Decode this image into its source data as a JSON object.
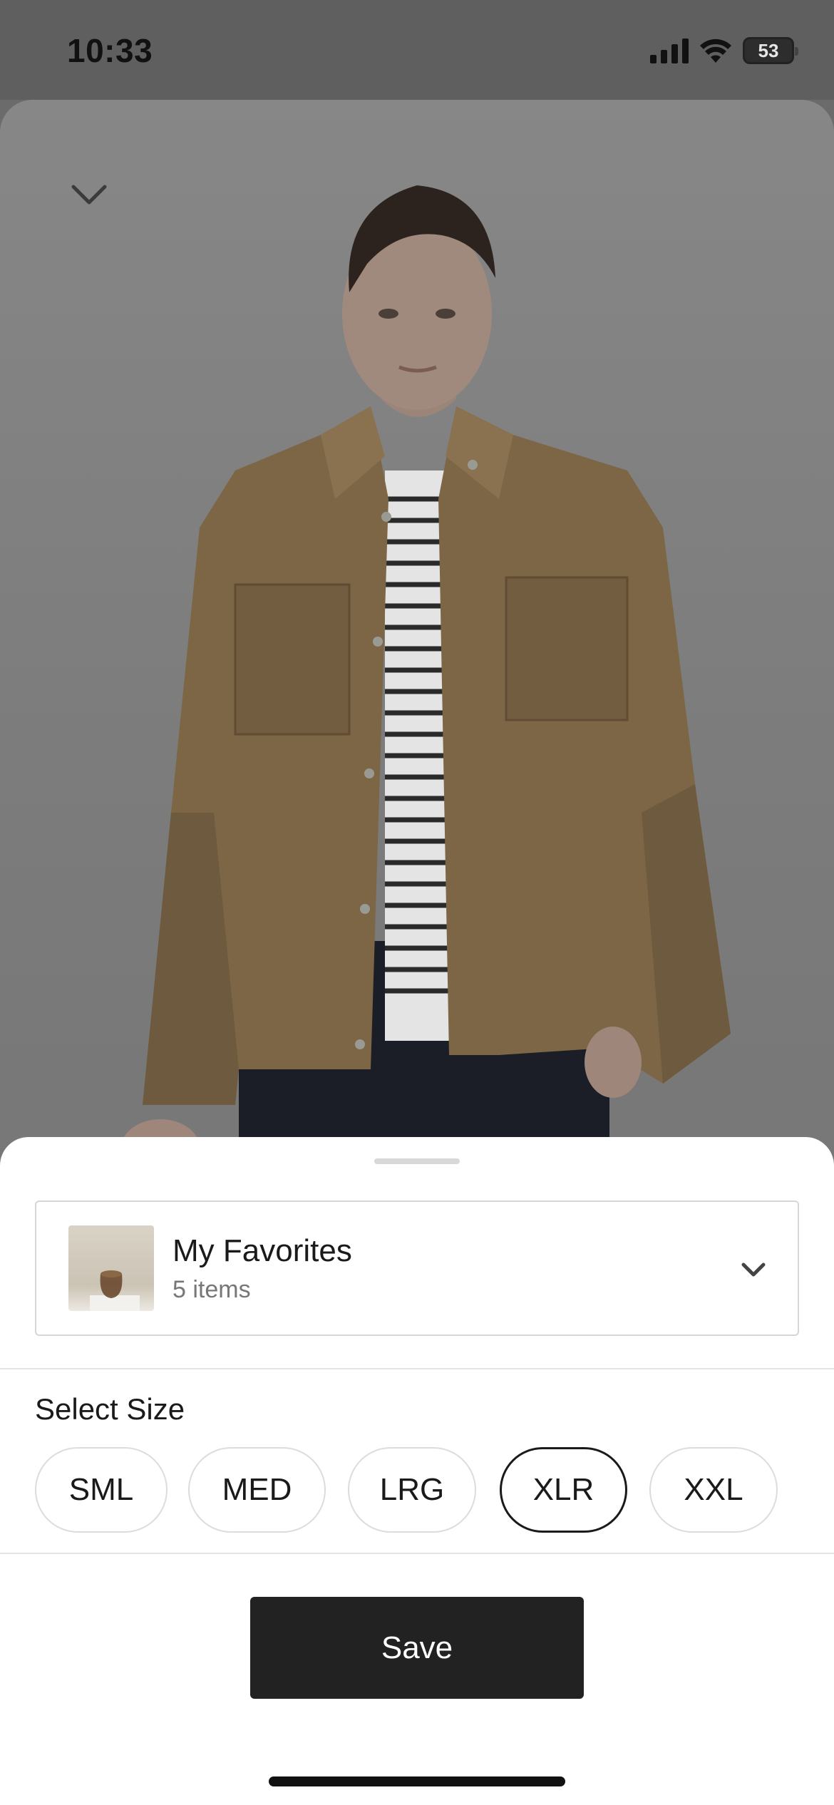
{
  "status_bar": {
    "time": "10:33",
    "battery": "53",
    "icons": [
      "cellular-signal-icon",
      "wifi-icon",
      "battery-icon"
    ]
  },
  "product": {
    "image": "model-wearing-tan-shirt-jacket",
    "collapse_icon": "chevron-down-icon"
  },
  "sheet": {
    "collection": {
      "name": "My Favorites",
      "count": "5 items",
      "thumbnail": "vase-thumbnail",
      "dropdown_icon": "chevron-down-icon"
    },
    "size": {
      "label": "Select Size",
      "options": [
        "SML",
        "MED",
        "LRG",
        "XLR",
        "XXL"
      ],
      "selected": "XLR"
    },
    "save_label": "Save"
  },
  "colors": {
    "overlay": "#6b6b6b",
    "jacket": "#7d6646",
    "button": "#222222",
    "sheet": "#ffffff"
  }
}
